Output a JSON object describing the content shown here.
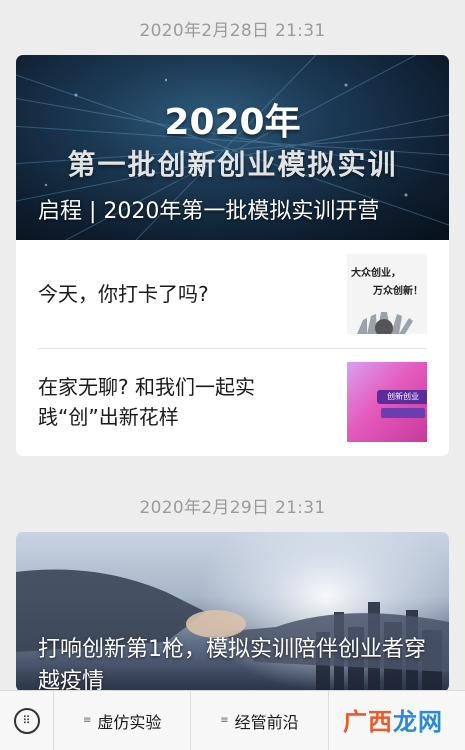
{
  "feed": {
    "groups": [
      {
        "timestamp": "2020年2月28日  21:31",
        "hero": {
          "banner_year": "2020年",
          "banner_sub": "第一批创新创业模拟实训",
          "title": "启程 | 2020年第一批模拟实训开营"
        },
        "articles": [
          {
            "title": "今天，你打卡了吗?",
            "thumb_text_1": "大众创业，",
            "thumb_text_2": "万众创新！"
          },
          {
            "title": "在家无聊? 和我们一起实践“创”出新花样",
            "thumb_text": "创新创业"
          }
        ]
      },
      {
        "timestamp": "2020年2月29日  21:31",
        "hero": {
          "title": "打响创新第1枪，模拟实训陪伴创业者穿越疫情"
        }
      }
    ]
  },
  "bottom_bar": {
    "keyboard_icon": "keyboard-icon",
    "menus": [
      {
        "label": "虚仿实验",
        "icon": "menu-lines-icon"
      },
      {
        "label": "经管前沿",
        "icon": "menu-lines-icon"
      }
    ]
  },
  "watermark": {
    "part_a": "广西",
    "part_b": "龙网"
  },
  "colors": {
    "background": "#ededed",
    "card": "#ffffff",
    "timestamp": "#9b9b9b",
    "watermark_a": "#ea5a2a",
    "watermark_b": "#2a8ad6"
  }
}
